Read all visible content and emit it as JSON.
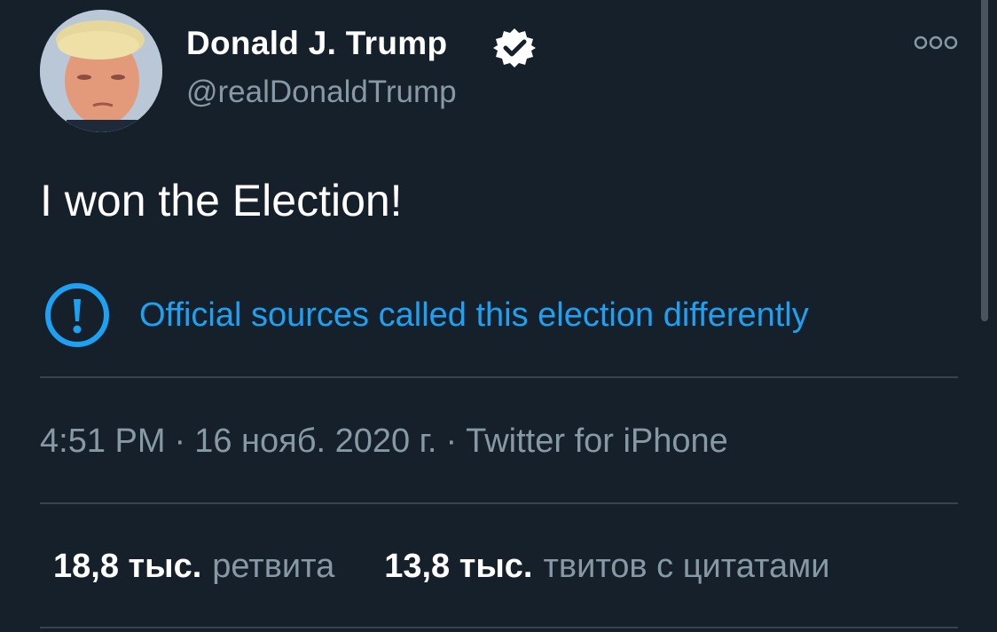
{
  "author": {
    "name": "Donald J. Trump",
    "handle": "@realDonaldTrump",
    "verified": true,
    "avatar_icon": "avatar-photo"
  },
  "tweet": {
    "text": "I won the Election!"
  },
  "notice": {
    "icon": "alert-circle-icon",
    "text": "Official sources called this election differently"
  },
  "meta": {
    "time": "4:51 PM",
    "separator": "·",
    "date": "16 нояб. 2020 г.",
    "source": "Twitter for iPhone"
  },
  "stats": {
    "retweets_count": "18,8 тыс.",
    "retweets_label": "ретвита",
    "quotes_count": "13,8 тыс.",
    "quotes_label": "твитов с цитатами"
  },
  "colors": {
    "background": "#15202b",
    "accent": "#1da1f2",
    "secondary_text": "#8899a6",
    "divider": "#38444d"
  }
}
